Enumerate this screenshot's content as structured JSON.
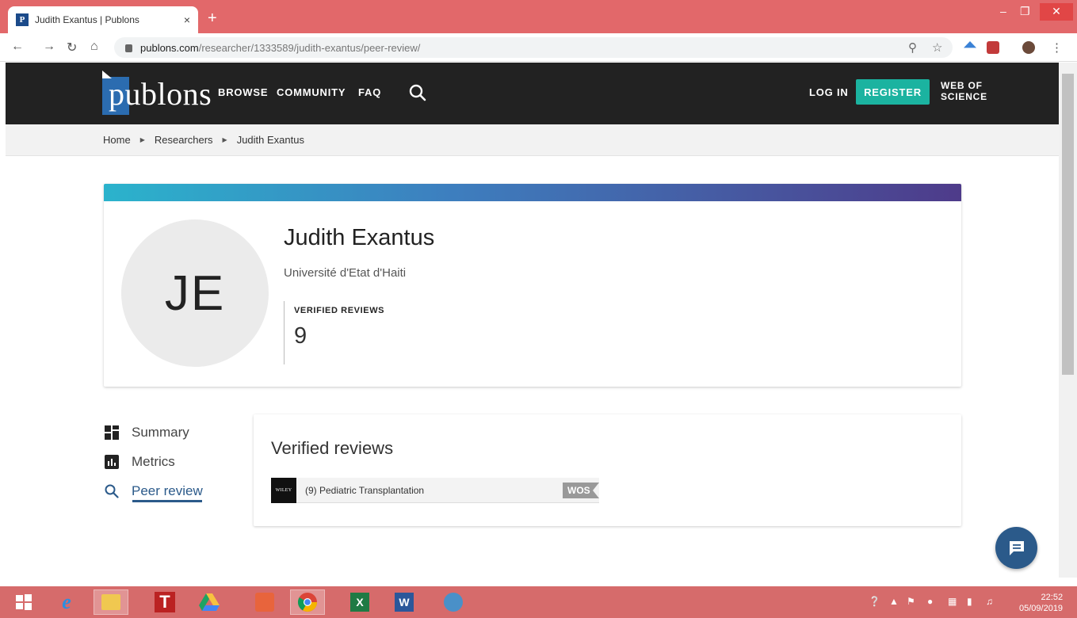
{
  "browser": {
    "tab_favicon": "P",
    "tab_title": "Judith Exantus | Publons",
    "tab_close": "×",
    "new_tab": "+",
    "url_host": "publons.com",
    "url_path": "/researcher/1333589/judith-exantus/peer-review/"
  },
  "header": {
    "logo": "publons",
    "nav": [
      "BROWSE",
      "COMMUNITY",
      "FAQ"
    ],
    "login": "LOG IN",
    "register": "REGISTER",
    "web_of_science_line1": "WEB OF",
    "web_of_science_line2": "SCIENCE"
  },
  "breadcrumb": [
    "Home",
    "Researchers",
    "Judith Exantus"
  ],
  "profile": {
    "initials": "JE",
    "name": "Judith Exantus",
    "institution": "Université d'Etat d'Haiti",
    "stat_label": "VERIFIED REVIEWS",
    "stat_value": "9"
  },
  "sidebar": {
    "items": [
      {
        "label": "Summary",
        "icon": "grid-icon"
      },
      {
        "label": "Metrics",
        "icon": "bar-chart-icon"
      },
      {
        "label": "Peer review",
        "icon": "search-icon"
      }
    ],
    "active": "Peer review"
  },
  "reviews": {
    "title": "Verified reviews",
    "rows": [
      {
        "publisher_logo": "WILEY",
        "journal": "(9) Pediatric Transplantation",
        "badge": "WOS"
      }
    ]
  },
  "taskbar": {
    "clock_time": "22:52",
    "clock_date": "05/09/2019"
  },
  "colors": {
    "chrome_frame": "#e2686a",
    "publons_header": "#222222",
    "register_button": "#1bb3a0",
    "accent_blue": "#2b5a8a",
    "gradient_start": "#2bb3cc",
    "gradient_end": "#4e3b8a"
  }
}
